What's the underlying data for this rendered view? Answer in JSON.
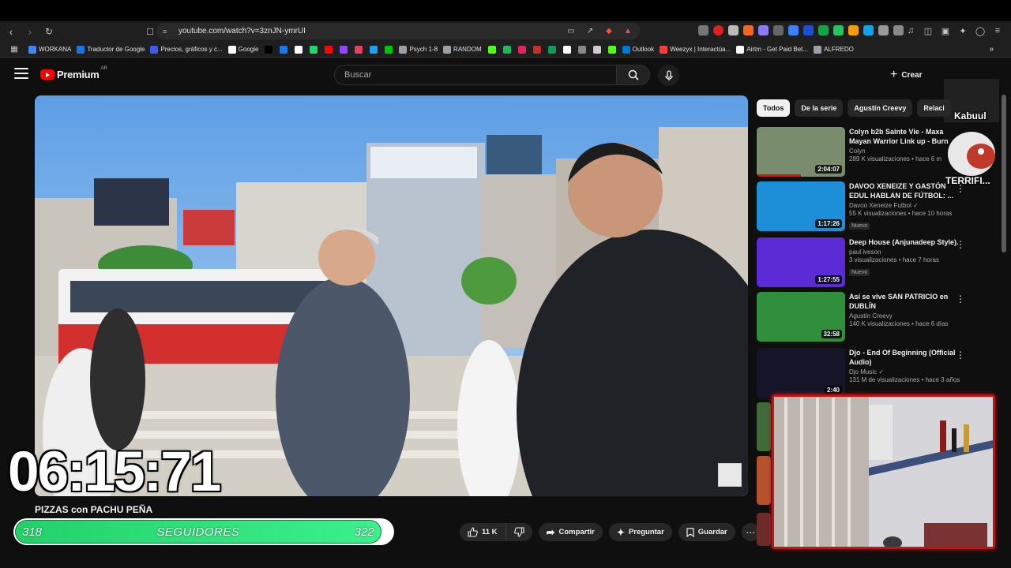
{
  "browser": {
    "url": "youtube.com/watch?v=3znJN-ymrUI",
    "bookmarks": [
      {
        "label": "WORKANA",
        "color": "#4285f4"
      },
      {
        "label": "Traductor de Google",
        "color": "#1a73e8"
      },
      {
        "label": "Precios, gráficos y c...",
        "color": "#3c5cf0"
      },
      {
        "label": "Google",
        "color": "#ffffff"
      },
      {
        "label": "",
        "color": "#000000"
      },
      {
        "label": "",
        "color": "#1877f2"
      },
      {
        "label": "",
        "color": "#ffffff"
      },
      {
        "label": "",
        "color": "#25d366"
      },
      {
        "label": "",
        "color": "#ff0000"
      },
      {
        "label": "",
        "color": "#9146ff"
      },
      {
        "label": "",
        "color": "#e4405f"
      },
      {
        "label": "",
        "color": "#1da1f2"
      },
      {
        "label": "",
        "color": "#00c800"
      },
      {
        "label": "Psych 1-8",
        "color": "#9aa0a6"
      },
      {
        "label": "RANDOM",
        "color": "#9aa0a6"
      },
      {
        "label": "",
        "color": "#53fc18"
      },
      {
        "label": "",
        "color": "#1db954"
      },
      {
        "label": "",
        "color": "#e0245e"
      },
      {
        "label": "",
        "color": "#c4302b"
      },
      {
        "label": "",
        "color": "#0f9d58"
      },
      {
        "label": "",
        "color": "#ffffff"
      },
      {
        "label": "",
        "color": "#888888"
      },
      {
        "label": "",
        "color": "#cccccc"
      },
      {
        "label": "",
        "color": "#53fc18"
      },
      {
        "label": "Outlook",
        "color": "#0078d4"
      },
      {
        "label": "Weezyx | Interactúa...",
        "color": "#ff3b3b"
      },
      {
        "label": "Airtm - Get Paid Bet...",
        "color": "#ffffff"
      },
      {
        "label": "ALFREDO",
        "color": "#9aa0a6"
      }
    ]
  },
  "header": {
    "logo_text": "Premium",
    "country_code": "AR",
    "search_placeholder": "Buscar",
    "create_label": "Crear"
  },
  "overlay": {
    "timer": "06:15:71",
    "followers_start": "318",
    "followers_label": "SEGUIDORES",
    "followers_goal": "322",
    "followers_progress": 0.97,
    "stream_name": "Kabuul",
    "stream_tag": "TERRIFI..."
  },
  "video": {
    "title": "PIZZAS con PACHU PEÑA",
    "likes": "11 K",
    "share_label": "Compartir",
    "ask_label": "Preguntar",
    "save_label": "Guardar"
  },
  "chips": [
    {
      "label": "Todos",
      "active": true
    },
    {
      "label": "De la serie",
      "active": false
    },
    {
      "label": "Agustín Creevy",
      "active": false
    },
    {
      "label": "Relaci",
      "active": false
    }
  ],
  "recommendations": [
    {
      "title": "Colyn b2b Sainte Vie - Maxa Mayan Warrior Link up - Burn",
      "channel": "Colyn",
      "meta": "289 K visualizaciones • hace 6 m",
      "duration": "2:04:07",
      "badge": "",
      "progress": 0.5,
      "thumb_color": "#7a8c6e"
    },
    {
      "title": "DAVOO XENEIZE Y GASTÓN EDUL HABLAN DE FÚTBOL: ...",
      "channel": "Davoo Xeneize Futbol ✓",
      "meta": "55 K visualizaciones • hace 10 horas",
      "duration": "1:17:26",
      "badge": "Nuevo",
      "progress": 0,
      "thumb_color": "#1d8fd9"
    },
    {
      "title": "Deep House (Anjunadeep Style).",
      "channel": "paul iveson",
      "meta": "3 visualizaciones • hace 7 horas",
      "duration": "1:27:55",
      "badge": "Nuevo",
      "progress": 0,
      "thumb_color": "#5b2bd6"
    },
    {
      "title": "Así se vive SAN PATRICIO en DUBLÍN",
      "channel": "Agustín Creevy",
      "meta": "140 K visualizaciones • hace 6 días",
      "duration": "32:58",
      "badge": "",
      "progress": 0,
      "thumb_color": "#2f8f3c"
    },
    {
      "title": "Djo - End Of Beginning (Official Audio)",
      "channel": "Djo Music ✓",
      "meta": "131 M de visualizaciones • hace 3 años",
      "duration": "2:40",
      "badge": "",
      "progress": 0,
      "thumb_color": "#15152a"
    }
  ]
}
